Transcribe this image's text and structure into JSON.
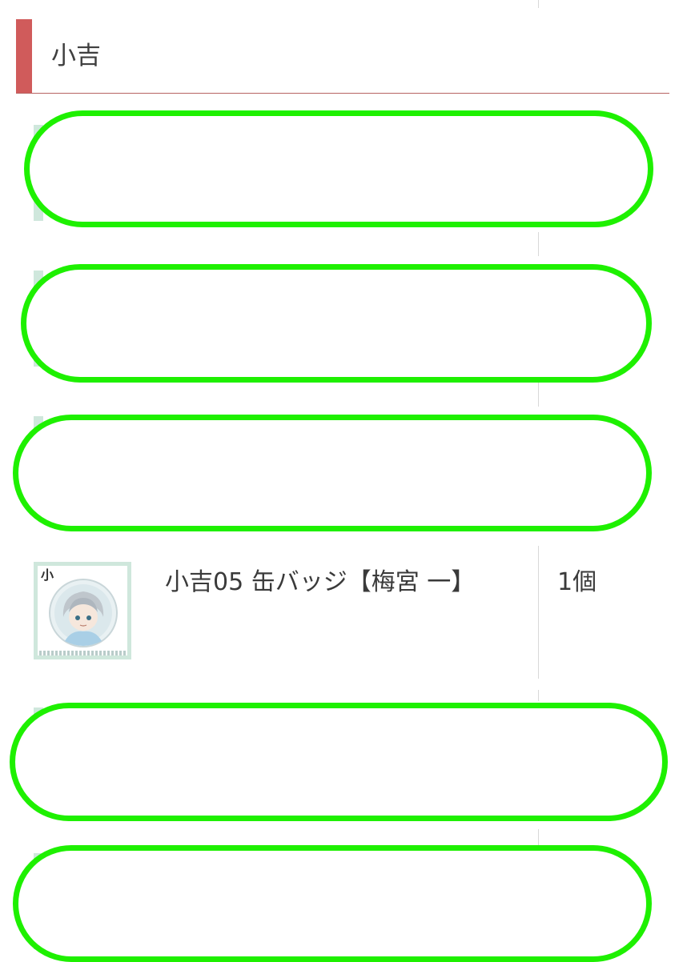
{
  "section": {
    "title": "小吉"
  },
  "items": [
    {
      "name": "",
      "quantity": "",
      "redacted": true
    },
    {
      "name": "",
      "quantity": "",
      "redacted": true
    },
    {
      "name": "",
      "quantity": "",
      "redacted": true
    },
    {
      "name": "小吉05 缶バッジ【梅宮 一】",
      "quantity": "1個",
      "redacted": false,
      "thumbnail": {
        "logo_text": "小",
        "icon": "character-can-badge-image"
      }
    },
    {
      "name": "",
      "quantity": "",
      "redacted": true
    },
    {
      "name": "",
      "quantity": "",
      "redacted": true
    }
  ],
  "colors": {
    "accent": "#d05b5b",
    "header_rule": "#b76462",
    "redaction": "#1ef000",
    "thumb_frame": "#cfe7dc",
    "text": "#3a3a3a"
  }
}
